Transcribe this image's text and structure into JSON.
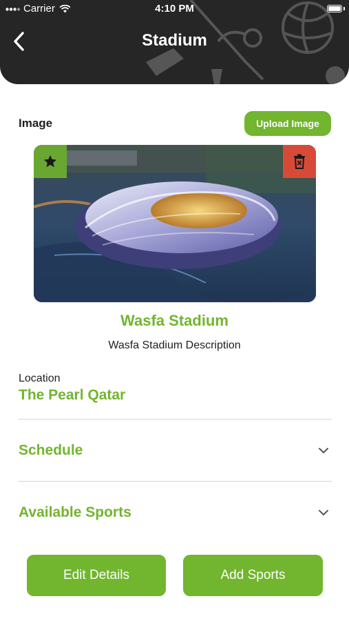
{
  "status_bar": {
    "carrier": "Carrier",
    "time": "4:10 PM"
  },
  "header": {
    "title": "Stadium",
    "back_icon": "chevron-left-icon"
  },
  "image_section": {
    "label": "Image",
    "upload_button": "Upload Image",
    "favorite_icon": "star-icon",
    "delete_icon": "trash-icon"
  },
  "stadium": {
    "name": "Wasfa Stadium",
    "description": "Wasfa Stadium Description"
  },
  "location": {
    "label": "Location",
    "value": "The Pearl Qatar"
  },
  "accordions": [
    {
      "label": "Schedule",
      "icon": "chevron-down-icon"
    },
    {
      "label": "Available Sports",
      "icon": "chevron-down-icon"
    }
  ],
  "actions": {
    "edit": "Edit Details",
    "add": "Add Sports"
  },
  "colors": {
    "accent": "#72b52e",
    "header": "#262626",
    "danger": "#d84a38"
  }
}
